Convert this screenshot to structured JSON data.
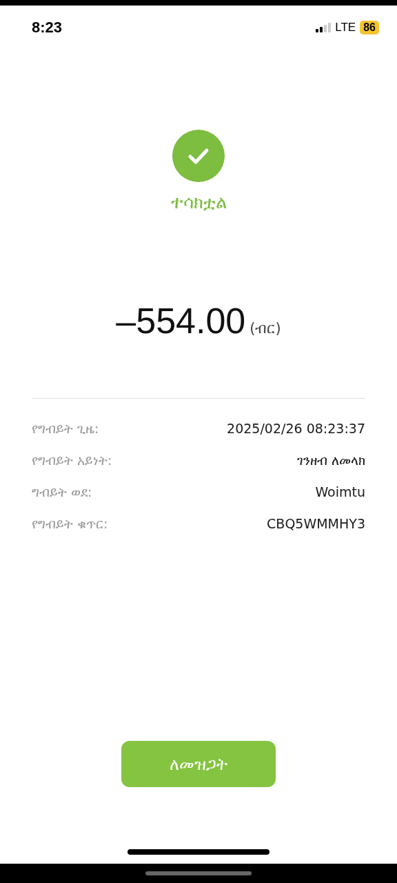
{
  "status_bar": {
    "time": "8:23",
    "network": "LTE",
    "battery": "86"
  },
  "result": {
    "success": true,
    "title": "ተሳክቷል"
  },
  "amount": {
    "value": "–554.00",
    "currency": "(ብር)"
  },
  "details": [
    {
      "label": "የግብይት ጊዜ:",
      "value": "2025/02/26 08:23:37"
    },
    {
      "label": "የግብይት አይነት:",
      "value": "ገንዘብ ለመላክ"
    },
    {
      "label": "ግብይት ወደ:",
      "value": "Woimtu"
    },
    {
      "label": "የግብይት ቁጥር:",
      "value": "CBQ5WMMHY3"
    }
  ],
  "close_button": {
    "label": "ለመዝጋት"
  }
}
